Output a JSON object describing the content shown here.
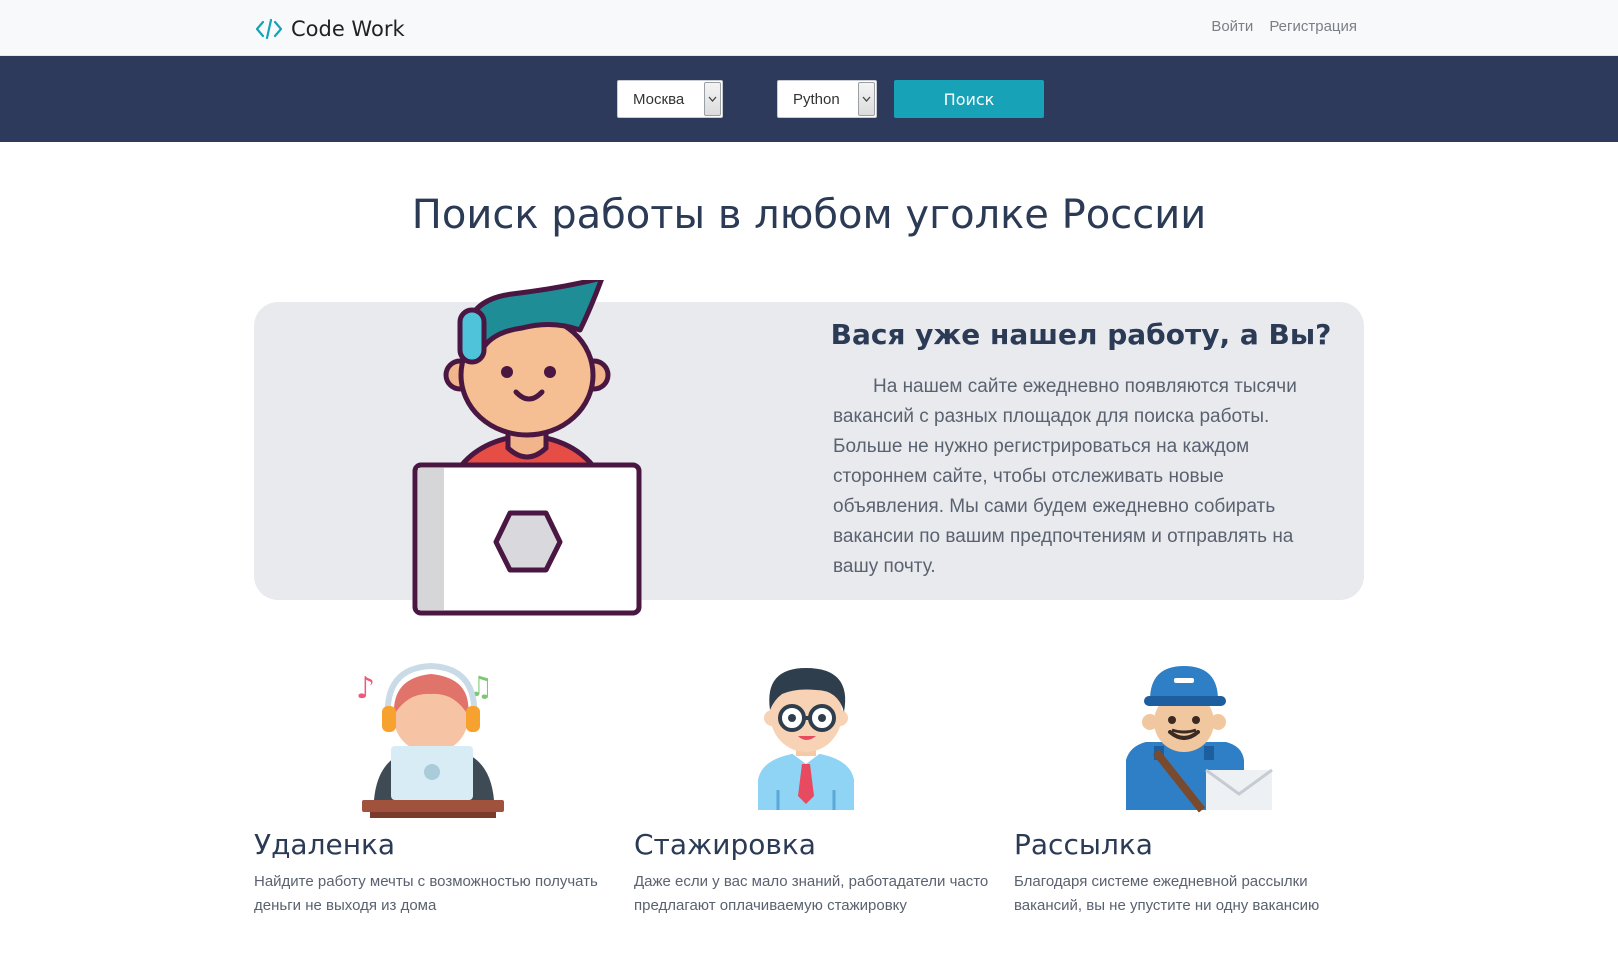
{
  "nav": {
    "brand": "Code Work",
    "login": "Войти",
    "register": "Регистрация"
  },
  "search": {
    "city": "Москва",
    "language": "Python",
    "button": "Поиск"
  },
  "headline": "Поиск работы в любом уголке России",
  "promo": {
    "title": "Вася уже нашел работу, а Вы?",
    "text": "На нашем сайте ежедневно появляются тысячи вакансий с разных площадок для поиска работы. Больше не нужно регистрироваться на каждом стороннем сайте, чтобы отслеживать новые объявления. Мы сами будем ежедневно собирать вакансии по вашим предпочтениям и отправлять на вашу почту."
  },
  "features": [
    {
      "title": "Удаленка",
      "text": "Найдите работу мечты с возможностью получать деньги не выходя из дома",
      "icon": "remote-worker-icon"
    },
    {
      "title": "Стажировка",
      "text": "Даже если у вас мало знаний, работадатели часто предлагают оплачиваемую стажировку",
      "icon": "intern-icon"
    },
    {
      "title": "Рассылка",
      "text": "Благодаря системе ежедневной рассылки вакансий, вы не упустите ни одну вакансию",
      "icon": "mailman-icon"
    }
  ],
  "colors": {
    "navbar_bg": "#f8f9fa",
    "searchbar_bg": "#2e3a5c",
    "search_button": "#17a2b8",
    "promo_bg": "#e9eaee",
    "heading": "#2b3a55",
    "brand_accent": "#17a2b8"
  }
}
